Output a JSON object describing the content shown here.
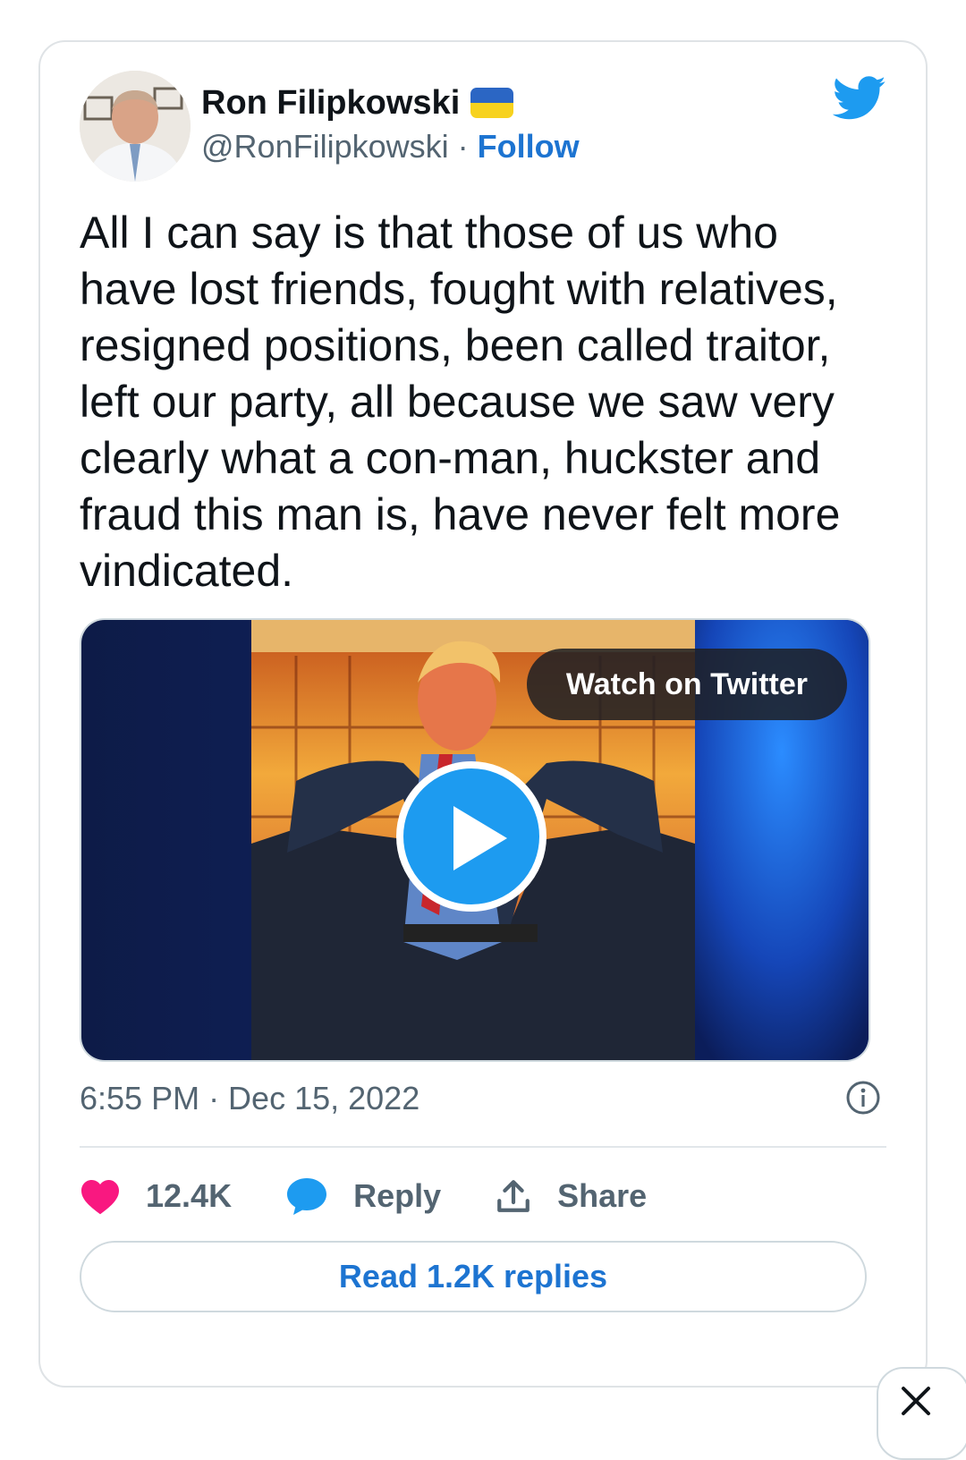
{
  "tweet": {
    "author": {
      "name": "Ron Filipkowski",
      "handle": "@RonFilipkowski",
      "separator": "·",
      "follow_label": "Follow",
      "badge_icon": "ukraine-flag-icon"
    },
    "text": "All I can say is that those of us who have lost friends, fought with relatives, resigned positions, been called traitor, left our party, all because we saw very clearly what a con-man, huckster and fraud this man is, have never felt more vindicated.",
    "media": {
      "watch_label": "Watch on Twitter",
      "play_icon": "play-icon"
    },
    "timestamp": "6:55 PM · Dec 15, 2022",
    "actions": {
      "likes": "12.4K",
      "reply_label": "Reply",
      "share_label": "Share"
    },
    "read_replies_label": "Read 1.2K replies"
  },
  "colors": {
    "accent": "#1d9bf0",
    "link": "#1d74d1",
    "like": "#f91880",
    "muted": "#536471"
  }
}
